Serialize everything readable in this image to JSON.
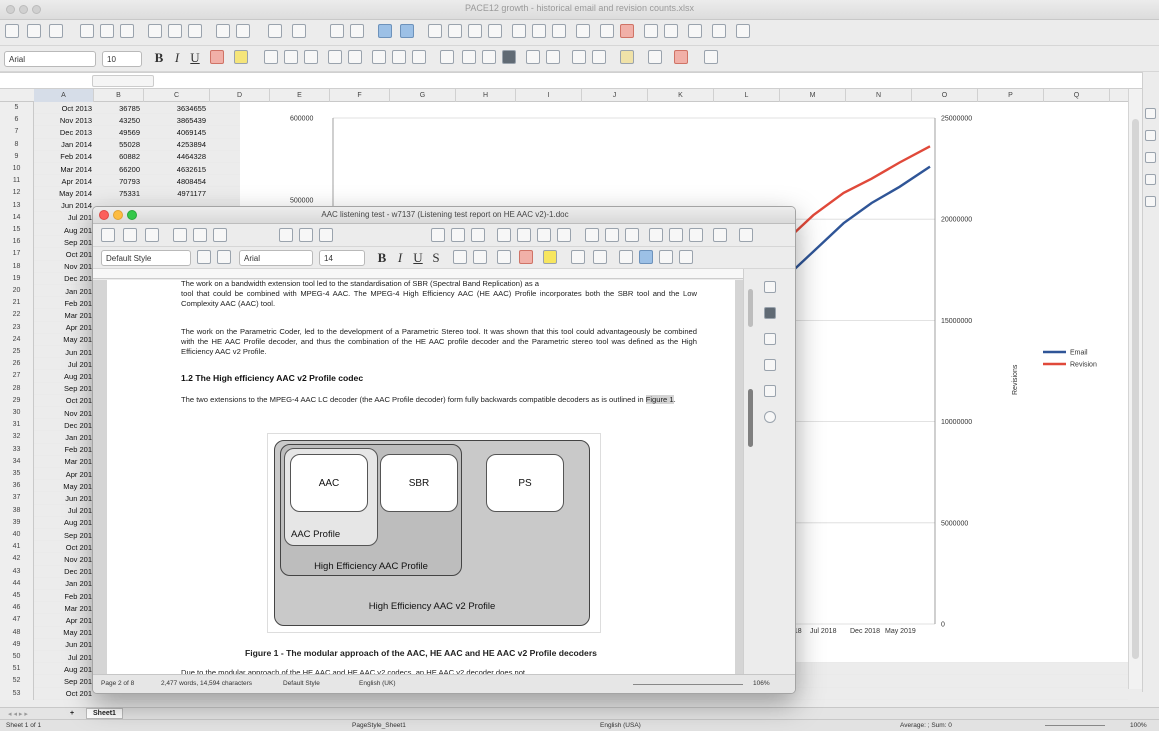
{
  "calc": {
    "window_title": "PACE12 growth - historical email and revision counts.xlsx",
    "font_name": "Arial",
    "font_size": "10",
    "columns": [
      "A",
      "B",
      "C",
      "D",
      "E",
      "F",
      "G",
      "H",
      "I",
      "J",
      "K",
      "L",
      "M",
      "N",
      "O",
      "P",
      "Q"
    ],
    "rows": [
      {
        "n": "5",
        "a": "Oct 2013",
        "b": "36785",
        "c": "3634655"
      },
      {
        "n": "6",
        "a": "Nov 2013",
        "b": "43250",
        "c": "3865439"
      },
      {
        "n": "7",
        "a": "Dec 2013",
        "b": "49569",
        "c": "4069145"
      },
      {
        "n": "8",
        "a": "Jan 2014",
        "b": "55028",
        "c": "4253894"
      },
      {
        "n": "9",
        "a": "Feb 2014",
        "b": "60882",
        "c": "4464328"
      },
      {
        "n": "10",
        "a": "Mar 2014",
        "b": "66200",
        "c": "4632615"
      },
      {
        "n": "11",
        "a": "Apr 2014",
        "b": "70793",
        "c": "4808454"
      },
      {
        "n": "12",
        "a": "May 2014",
        "b": "75331",
        "c": "4971177"
      },
      {
        "n": "13",
        "a": "Jun 2014",
        "b": "",
        "c": ""
      },
      {
        "n": "14",
        "a": "Jul 201",
        "b": "",
        "c": ""
      },
      {
        "n": "15",
        "a": "Aug 201",
        "b": "",
        "c": ""
      },
      {
        "n": "16",
        "a": "Sep 201",
        "b": "",
        "c": ""
      },
      {
        "n": "17",
        "a": "Oct 201",
        "b": "",
        "c": ""
      },
      {
        "n": "18",
        "a": "Nov 201",
        "b": "",
        "c": ""
      },
      {
        "n": "19",
        "a": "Dec 201",
        "b": "",
        "c": ""
      },
      {
        "n": "20",
        "a": "Jan 201",
        "b": "",
        "c": ""
      },
      {
        "n": "21",
        "a": "Feb 201",
        "b": "",
        "c": ""
      },
      {
        "n": "22",
        "a": "Mar 201",
        "b": "",
        "c": ""
      },
      {
        "n": "23",
        "a": "Apr 201",
        "b": "",
        "c": ""
      },
      {
        "n": "24",
        "a": "May 201",
        "b": "",
        "c": ""
      },
      {
        "n": "25",
        "a": "Jun 201",
        "b": "",
        "c": ""
      },
      {
        "n": "26",
        "a": "Jul 201",
        "b": "",
        "c": ""
      },
      {
        "n": "27",
        "a": "Aug 201",
        "b": "",
        "c": ""
      },
      {
        "n": "28",
        "a": "Sep 201",
        "b": "",
        "c": ""
      },
      {
        "n": "29",
        "a": "Oct 201",
        "b": "",
        "c": ""
      },
      {
        "n": "30",
        "a": "Nov 201",
        "b": "",
        "c": ""
      },
      {
        "n": "31",
        "a": "Dec 201",
        "b": "",
        "c": ""
      },
      {
        "n": "32",
        "a": "Jan 201",
        "b": "",
        "c": ""
      },
      {
        "n": "33",
        "a": "Feb 201",
        "b": "",
        "c": ""
      },
      {
        "n": "34",
        "a": "Mar 201",
        "b": "",
        "c": ""
      },
      {
        "n": "35",
        "a": "Apr 201",
        "b": "",
        "c": ""
      },
      {
        "n": "36",
        "a": "May 201",
        "b": "",
        "c": ""
      },
      {
        "n": "37",
        "a": "Jun 201",
        "b": "",
        "c": ""
      },
      {
        "n": "38",
        "a": "Jul 201",
        "b": "",
        "c": ""
      },
      {
        "n": "39",
        "a": "Aug 201",
        "b": "",
        "c": ""
      },
      {
        "n": "40",
        "a": "Sep 201",
        "b": "",
        "c": ""
      },
      {
        "n": "41",
        "a": "Oct 201",
        "b": "",
        "c": ""
      },
      {
        "n": "42",
        "a": "Nov 201",
        "b": "",
        "c": ""
      },
      {
        "n": "43",
        "a": "Dec 201",
        "b": "",
        "c": ""
      },
      {
        "n": "44",
        "a": "Jan 201",
        "b": "",
        "c": ""
      },
      {
        "n": "45",
        "a": "Feb 201",
        "b": "",
        "c": ""
      },
      {
        "n": "46",
        "a": "Mar 201",
        "b": "",
        "c": ""
      },
      {
        "n": "47",
        "a": "Apr 201",
        "b": "",
        "c": ""
      },
      {
        "n": "48",
        "a": "May 201",
        "b": "",
        "c": ""
      },
      {
        "n": "49",
        "a": "Jun 201",
        "b": "",
        "c": ""
      },
      {
        "n": "50",
        "a": "Jul 201",
        "b": "",
        "c": ""
      },
      {
        "n": "51",
        "a": "Aug 201",
        "b": "",
        "c": ""
      },
      {
        "n": "52",
        "a": "Sep 201",
        "b": "",
        "c": ""
      },
      {
        "n": "53",
        "a": "Oct 201",
        "b": "",
        "c": ""
      }
    ],
    "sheet_tab": "Sheet1",
    "status": {
      "sheet": "Sheet 1 of 1",
      "page_style": "PageStyle_Sheet1",
      "language": "English (USA)",
      "summary": "Average: ; Sum: 0",
      "zoom": "100%"
    }
  },
  "chart_data": {
    "type": "line",
    "left_axis_ticks": [
      "600000",
      "500000"
    ],
    "right_axis_ticks": [
      "25000000",
      "20000000",
      "15000000",
      "10000000",
      "5000000",
      "0"
    ],
    "right_axis_label": "Revisions",
    "x_tick_labels": [
      "Jul 2018",
      "Dec 2018",
      "May 2019"
    ],
    "x_tick_prefix": "018",
    "ylim_right": [
      0,
      25000000
    ],
    "legend_position": "right",
    "series": [
      {
        "name": "Email",
        "color": "#2f5597",
        "points": [
          [
            0.0,
            16000000
          ],
          [
            0.12,
            17000000
          ],
          [
            0.25,
            18400000
          ],
          [
            0.38,
            19800000
          ],
          [
            0.5,
            20800000
          ],
          [
            0.62,
            21600000
          ],
          [
            0.75,
            22600000
          ]
        ]
      },
      {
        "name": "Revision",
        "color": "#e0493a",
        "points": [
          [
            0.0,
            17800000
          ],
          [
            0.12,
            18800000
          ],
          [
            0.25,
            20200000
          ],
          [
            0.38,
            21300000
          ],
          [
            0.5,
            22000000
          ],
          [
            0.62,
            22800000
          ],
          [
            0.75,
            23600000
          ]
        ]
      }
    ]
  },
  "writer": {
    "window_title": "AAC listening test - w7137 (Listening test report on HE AAC v2)-1.doc",
    "paragraph_style": "Default Style",
    "font_name": "Arial",
    "font_size": "14",
    "partial_line": "The work on a bandwidth extension tool led to the standardisation of SBR (Spectral Band Replication) as a",
    "para1": "tool that could be combined with MPEG-4 AAC. The MPEG-4 High Efficiency AAC (HE AAC) Profile incorporates both the SBR tool and the Low Complexity AAC (AAC) tool.",
    "para2": "The work on the Parametric Coder, led to the development of a Parametric Stereo tool. It was shown that this tool could advantageously be combined with the HE AAC Profile decoder, and thus the combination of the HE AAC profile decoder and the Parametric stereo tool was defined as the High Efficiency AAC v2 Profile.",
    "heading": "1.2   The High efficiency AAC v2 Profile codec",
    "para3_a": "The two extensions to the MPEG-4 AAC LC decoder (the AAC Profile decoder) form fully backwards compatible decoders as is outlined in ",
    "para3_ref": "Figure 1",
    "para3_b": ".",
    "diagram": {
      "aac": "AAC",
      "sbr": "SBR",
      "ps": "PS",
      "aac_profile": "AAC Profile",
      "he_profile": "High Efficiency AAC Profile",
      "hev2_profile": "High Efficiency AAC v2 Profile"
    },
    "caption": "Figure 1 - The modular approach of the AAC, HE AAC and HE AAC v2 Profile decoders",
    "partial_bottom": "Due to the modular approach of the HE AAC and HE AAC v2 codecs, an HE AAC v2 decoder does not",
    "status": {
      "page": "Page 2 of 8",
      "words": "2,477 words, 14,594 characters",
      "style": "Default Style",
      "language": "English (UK)",
      "zoom": "106%"
    }
  }
}
